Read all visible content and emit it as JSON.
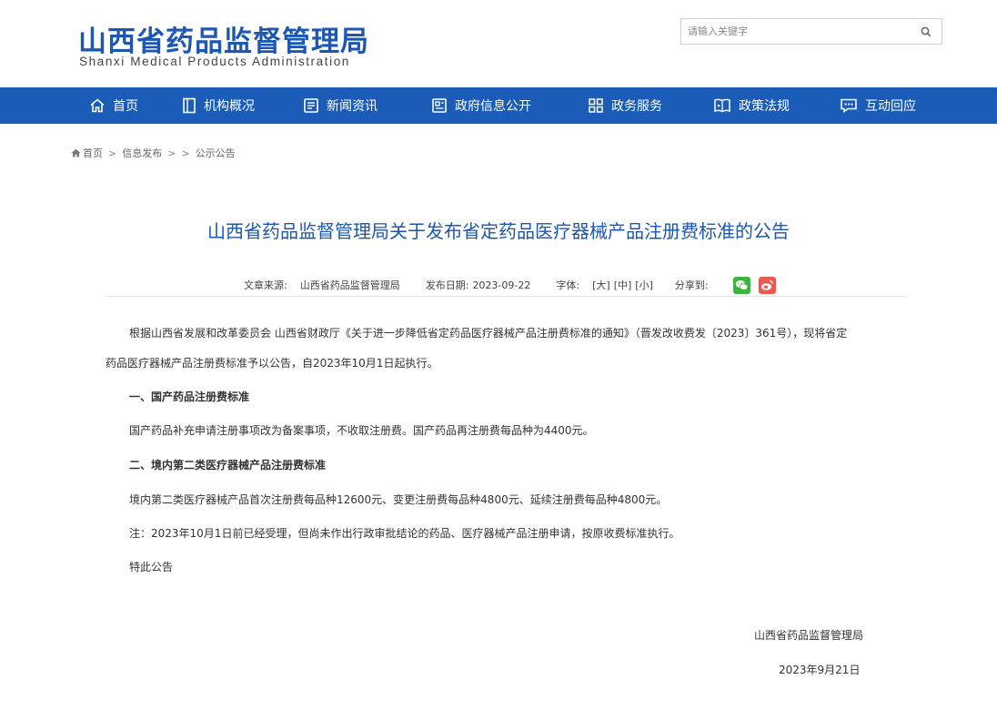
{
  "header": {
    "logo_cn": "山西省药品监督管理局",
    "logo_en": "Shanxi Medical Products Administration",
    "search_placeholder": "请输入关键字"
  },
  "nav": [
    {
      "label": "首页",
      "icon": "home-icon"
    },
    {
      "label": "机构概况",
      "icon": "document-icon"
    },
    {
      "label": "新闻资讯",
      "icon": "news-icon"
    },
    {
      "label": "政府信息公开",
      "icon": "info-board-icon"
    },
    {
      "label": "政务服务",
      "icon": "grid-icon"
    },
    {
      "label": "政策法规",
      "icon": "book-icon"
    },
    {
      "label": "互动回应",
      "icon": "chat-icon"
    }
  ],
  "breadcrumb": {
    "home": "首页",
    "level1": "信息发布",
    "level2": "公示公告",
    "separator": ">"
  },
  "article": {
    "title": "山西省药品监督管理局关于发布省定药品医疗器械产品注册费标准的公告",
    "source_label": "文章来源:",
    "source": "山西省药品监督管理局",
    "date_label": "发布日期:",
    "date": "2023-09-22",
    "font_label": "字体:",
    "font_large": "[大]",
    "font_medium": "[中]",
    "font_small": "[小]",
    "share_label": "分享到:",
    "paragraphs": [
      "根据山西省发展和改革委员会 山西省财政厅《关于进一步降低省定药品医疗器械产品注册费标准的通知》（晋发改收费发〔2023〕361号），现将省定",
      "药品医疗器械产品注册费标准予以公告，自2023年10月1日起执行。",
      "一、国产药品注册费标准",
      "国产药品补充申请注册事项改为备案事项，不收取注册费。国产药品再注册费每品种为4400元。",
      "二、境内第二类医疗器械产品注册费标准",
      "境内第二类医疗器械产品首次注册费每品种12600元、变更注册费每品种4800元、延续注册费每品种4800元。",
      "注：2023年10月1日前已经受理，但尚未作出行政审批结论的药品、医疗器械产品注册申请，按原收费标准执行。",
      "特此公告"
    ],
    "signer": "山西省药品监督管理局",
    "sign_date": "2023年9月21日"
  },
  "colors": {
    "brand_blue": "#1a5cb8",
    "title_blue": "#1b57b3",
    "wechat_green": "#3fb33f",
    "weibo_red": "#e9594f"
  }
}
